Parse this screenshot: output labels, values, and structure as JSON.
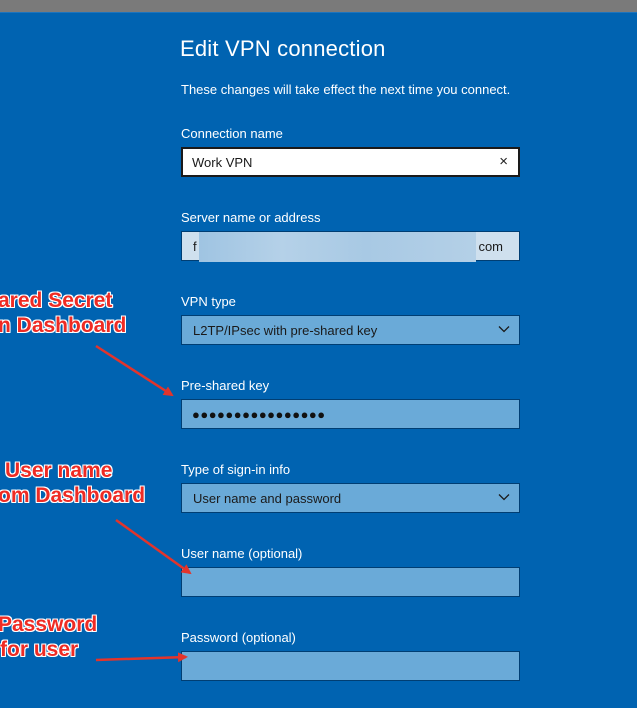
{
  "dialog": {
    "title": "Edit VPN connection",
    "subtitle": "These changes will take effect the next time you connect."
  },
  "fields": {
    "connection_name": {
      "label": "Connection name",
      "value": "Work VPN",
      "clear_icon": "×"
    },
    "server": {
      "label": "Server name or address",
      "value_start": "f",
      "value_end": "com"
    },
    "vpn_type": {
      "label": "VPN type",
      "value": "L2TP/IPsec with pre-shared key"
    },
    "preshared_key": {
      "label": "Pre-shared key",
      "value": "●●●●●●●●●●●●●●●●"
    },
    "signin_type": {
      "label": "Type of sign-in info",
      "value": "User name and password"
    },
    "username": {
      "label": "User name (optional)",
      "value": ""
    },
    "password": {
      "label": "Password (optional)",
      "value": ""
    }
  },
  "annotations": {
    "shared_secret": {
      "line1": "ared Secret",
      "line2": "n Dashboard"
    },
    "user_name": {
      "line1": "User name",
      "line2": "om Dashboard"
    },
    "password": {
      "line1": "Password",
      "line2": "for user"
    }
  },
  "colors": {
    "background": "#0063b1",
    "field_fill": "#6aaad8",
    "annotation_red": "#ee2b24"
  }
}
